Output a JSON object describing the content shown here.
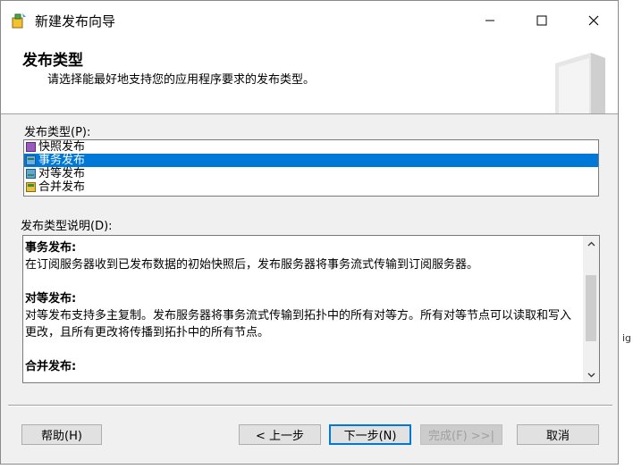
{
  "window": {
    "title": "新建发布向导"
  },
  "header": {
    "title": "发布类型",
    "subtitle": "请选择能最好地支持您的应用程序要求的发布类型。"
  },
  "type_section": {
    "label": "发布类型(P):",
    "items": [
      {
        "label": "快照发布",
        "icon": "snapshot-icon",
        "selected": false
      },
      {
        "label": "事务发布",
        "icon": "transactional-icon",
        "selected": true
      },
      {
        "label": "对等发布",
        "icon": "peer-to-peer-icon",
        "selected": false
      },
      {
        "label": "合并发布",
        "icon": "merge-icon",
        "selected": false
      }
    ]
  },
  "description_section": {
    "label": "发布类型说明(D):",
    "sections": [
      {
        "title": "事务发布:",
        "text": "在订阅服务器收到已发布数据的初始快照后，发布服务器将事务流式传输到订阅服务器。"
      },
      {
        "title": "对等发布:",
        "text": "对等发布支持多主复制。发布服务器将事务流式传输到拓扑中的所有对等方。所有对等节点可以读取和写入更改，且所有更改将传播到拓扑中的所有节点。"
      },
      {
        "title": "合并发布:",
        "text": ""
      }
    ]
  },
  "buttons": {
    "help": "帮助(H)",
    "back": "< 上一步",
    "next": "下一步(N)",
    "finish": "完成(F) >>|",
    "cancel": "取消"
  },
  "side_fragment": "ig",
  "colors": {
    "selection": "#0078d7",
    "dialog_bg": "#f0f0f0"
  }
}
